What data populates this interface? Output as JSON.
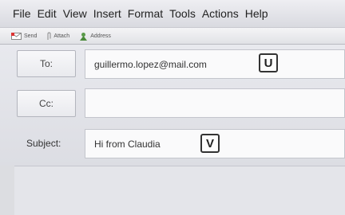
{
  "menu": [
    "File",
    "Edit",
    "View",
    "Insert",
    "Format",
    "Tools",
    "Actions",
    "Help"
  ],
  "toolbar": {
    "send": "Send",
    "attach": "Attach",
    "address": "Address"
  },
  "header": {
    "to_label": "To:",
    "to_value": "guillermo.lopez@mail.com",
    "to_tag": "U",
    "cc_label": "Cc:",
    "cc_value": "",
    "subject_label": "Subject:",
    "subject_value": "Hi from Claudia",
    "subject_tag": "V"
  }
}
